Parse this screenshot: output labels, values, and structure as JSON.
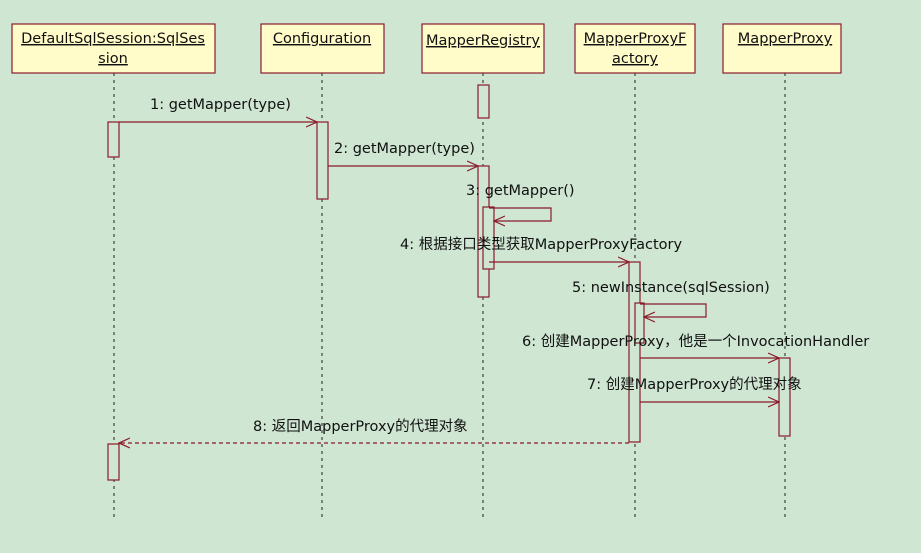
{
  "colors": {
    "background": "#cfe6d2",
    "participant_fill": "#fffcc9",
    "line": "#8b1a2a",
    "lifeline": "#222222",
    "text": "#111111"
  },
  "participants": [
    {
      "id": "session",
      "lines": [
        "DefaultSqlSession:SqlSes",
        "sion"
      ]
    },
    {
      "id": "config",
      "lines": [
        "Configuration"
      ]
    },
    {
      "id": "registry",
      "lines": [
        "MapperRegistry"
      ]
    },
    {
      "id": "factory",
      "lines": [
        "MapperProxyF",
        "actory"
      ]
    },
    {
      "id": "proxy",
      "lines": [
        "MapperProxy"
      ]
    }
  ],
  "messages": [
    {
      "label": "1: getMapper(type)",
      "from": "session",
      "to": "config",
      "style": "call"
    },
    {
      "label": "2: getMapper(type)",
      "from": "config",
      "to": "registry",
      "style": "call"
    },
    {
      "label": "3: getMapper()",
      "from": "registry",
      "to": "registry",
      "style": "self"
    },
    {
      "label": "4: 根据接口类型获取MapperProxyFactory",
      "from": "registry",
      "to": "factory",
      "style": "call"
    },
    {
      "label": "5: newInstance(sqlSession)",
      "from": "factory",
      "to": "factory",
      "style": "self"
    },
    {
      "label": "6: 创建MapperProxy，他是一个InvocationHandler",
      "from": "factory",
      "to": "proxy",
      "style": "call"
    },
    {
      "label": "7: 创建MapperProxy的代理对象",
      "from": "factory",
      "to": "proxy",
      "style": "call"
    },
    {
      "label": "8: 返回MapperProxy的代理对象",
      "from": "factory",
      "to": "session",
      "style": "return"
    }
  ]
}
